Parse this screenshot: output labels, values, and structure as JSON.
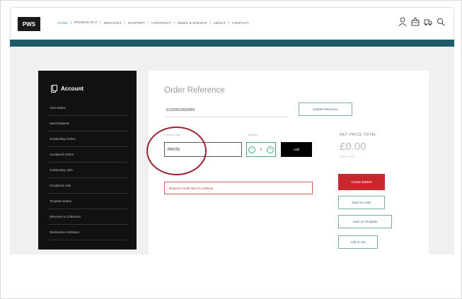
{
  "logo": "PWS",
  "nav": [
    "HOME",
    "PRODUCTS ▾",
    "SERVICES",
    "SUPPORT",
    "CONTRACT",
    "NEWS & EVENTS",
    "ABOUT",
    "CONTACT"
  ],
  "sidebar": {
    "heading": "Account",
    "items": [
      "View Basket",
      "Saved Baskets",
      "Outstanding Orders",
      "Completed Orders",
      "Outstanding Jobs",
      "Completed Jobs",
      "Template Orders",
      "Deliveries & Collections",
      "Worksurface Estimator"
    ]
  },
  "order": {
    "title": "Order Reference",
    "reference_value": "EC020016509456",
    "update_label": "Update Reference",
    "code_label": "Product Code",
    "code_value": "PROTE",
    "qty_label": "Quantity",
    "qty_value": "1",
    "qty_minus": "−",
    "qty_plus": "+",
    "add_label": "Add",
    "error": "Requires credit lines to continue"
  },
  "totals": {
    "label": "NET PRICE TOTAL",
    "value": "£0.00",
    "vat_note": "(Excl. VAT)"
  },
  "actions": {
    "create": "Create Basket",
    "save": "Save for Later",
    "template": "Save as Template",
    "add_job": "Add to Job"
  },
  "colors": {
    "accent_teal": "#1f5c69",
    "create_red": "#c8282d",
    "highlight_circle": "#9a2232"
  }
}
